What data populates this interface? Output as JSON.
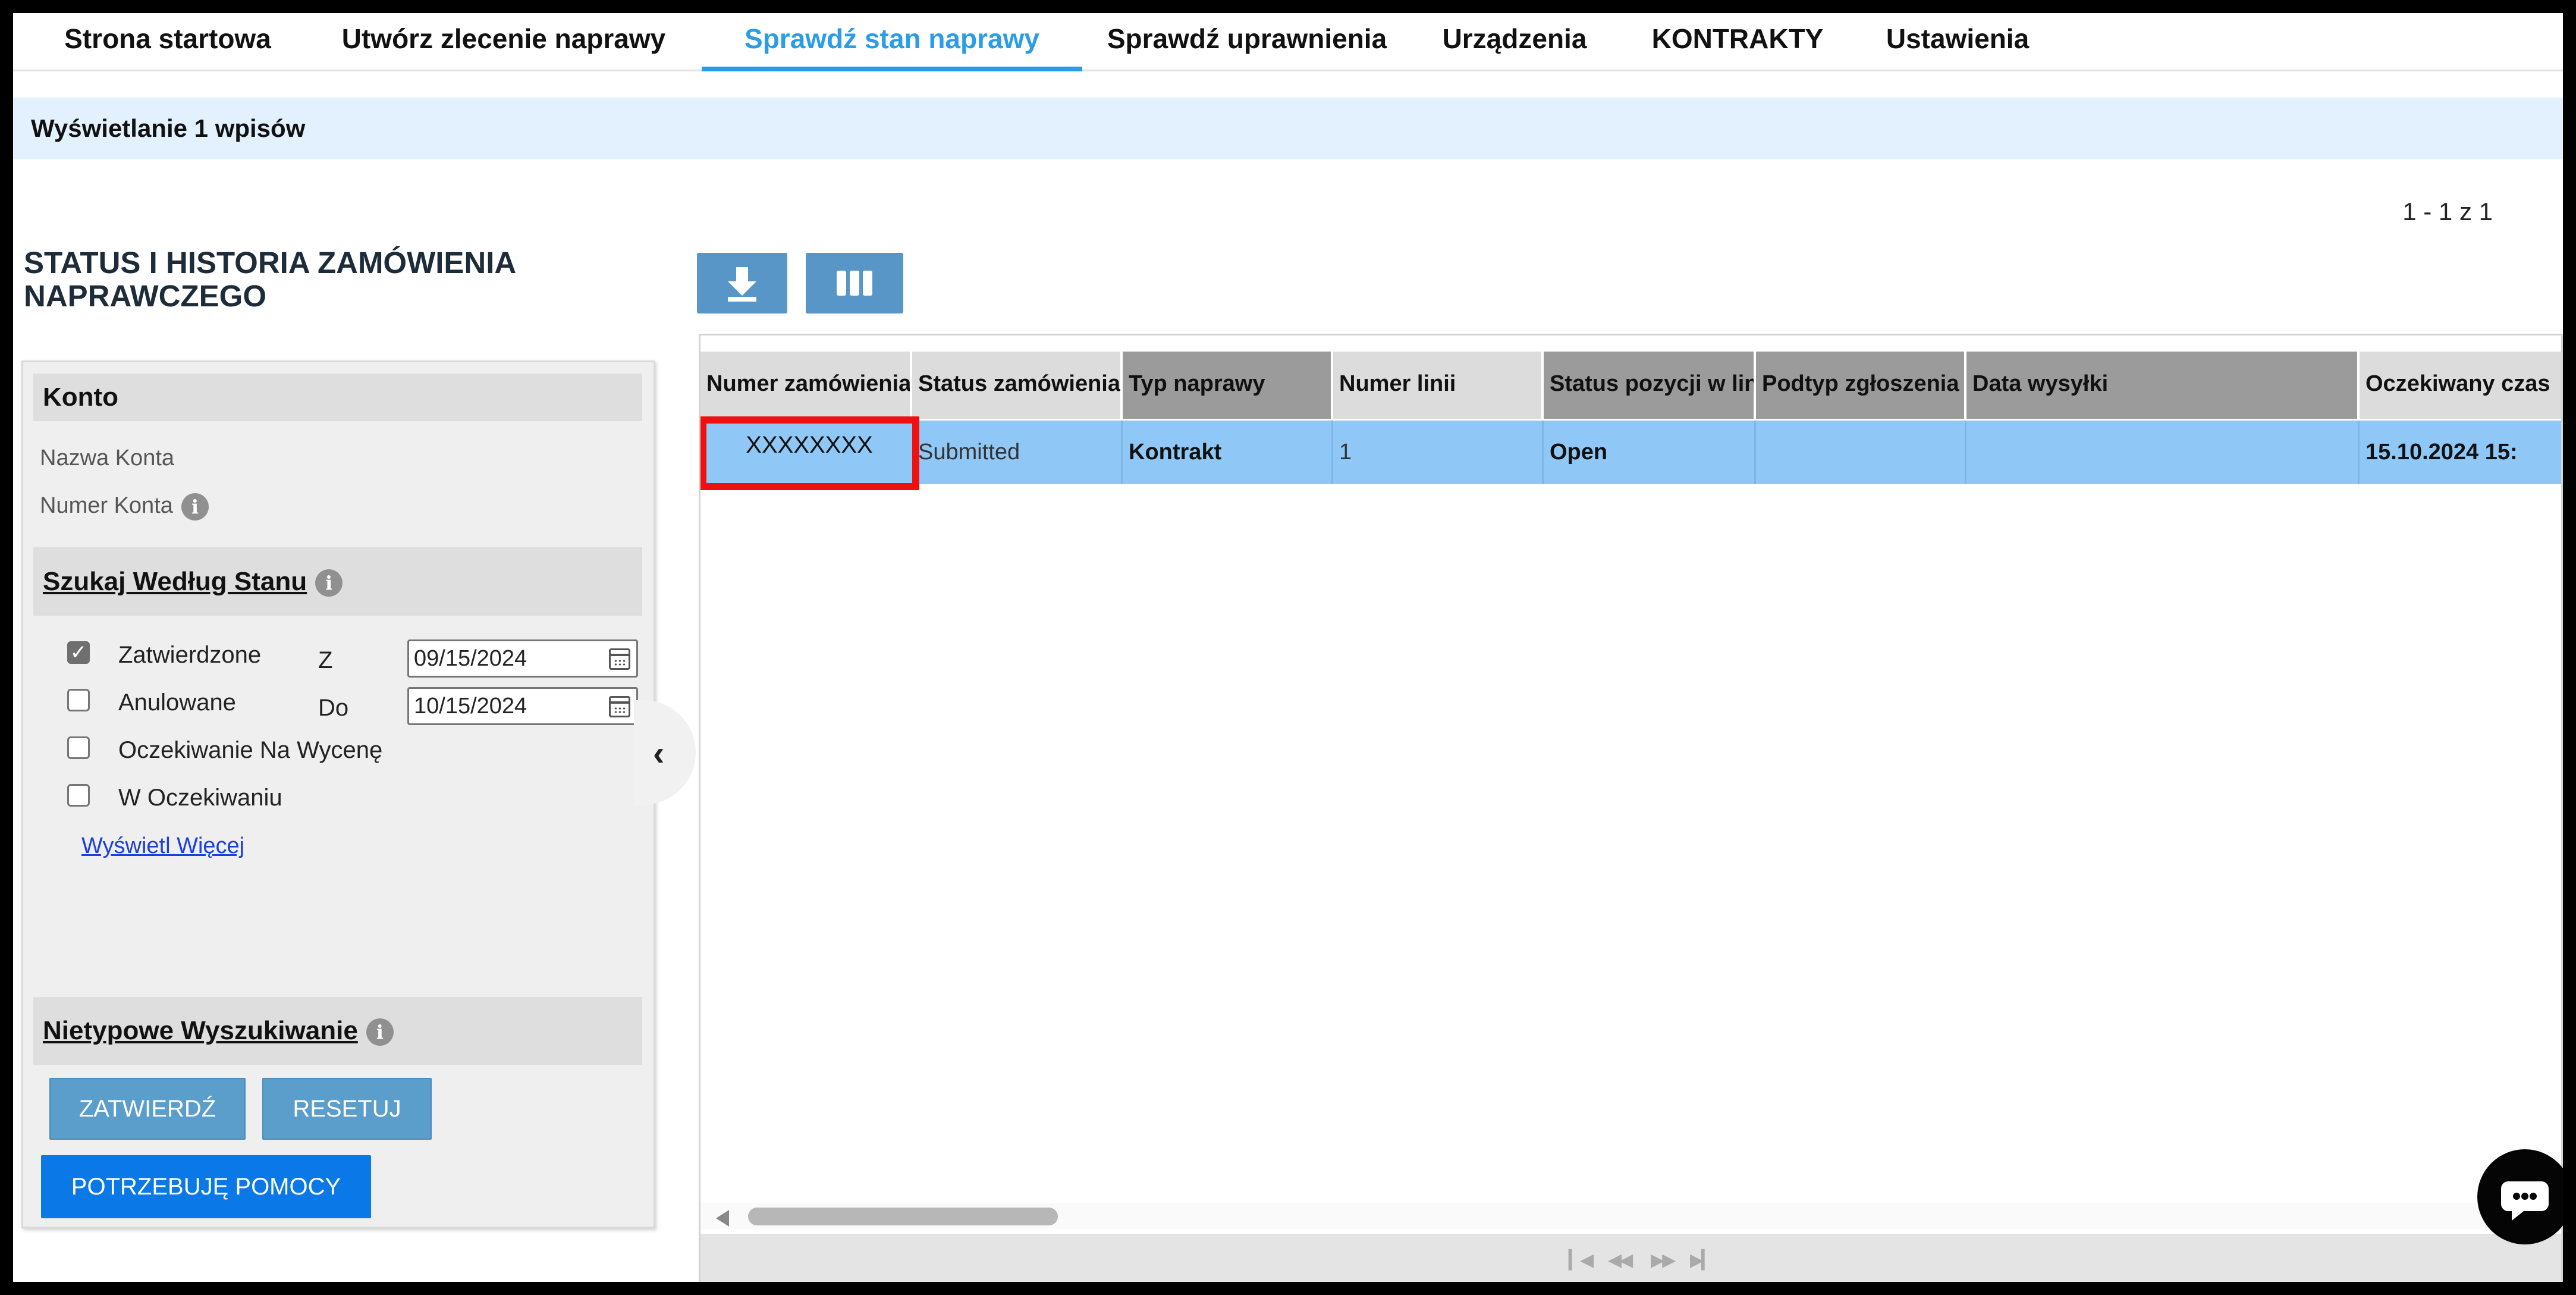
{
  "nav": {
    "tabs": [
      {
        "label": "Strona startowa",
        "active": false
      },
      {
        "label": "Utwórz zlecenie naprawy",
        "active": false
      },
      {
        "label": "Sprawdź stan naprawy",
        "active": true
      },
      {
        "label": "Sprawdź uprawnienia",
        "active": false
      },
      {
        "label": "Urządzenia",
        "active": false
      },
      {
        "label": "KONTRAKTY",
        "active": false
      },
      {
        "label": "Ustawienia",
        "active": false
      }
    ]
  },
  "info_bar": "Wyświetlanie 1 wpisów",
  "pagination_text": "1 - 1 z 1",
  "page_title": "STATUS I HISTORIA ZAMÓWIENIA NAPRAWCZEGO",
  "filters": {
    "account_heading": "Konto",
    "account_name_label": "Nazwa Konta",
    "account_number_label": "Numer Konta",
    "status_heading": "Szukaj Według Stanu",
    "statuses": [
      {
        "label": "Zatwierdzone",
        "checked": true
      },
      {
        "label": "Anulowane",
        "checked": false
      },
      {
        "label": "Oczekiwanie Na Wycenę",
        "checked": false
      },
      {
        "label": "W Oczekiwaniu",
        "checked": false
      }
    ],
    "date_from_label": "Z",
    "date_from": "09/15/2024",
    "date_to_label": "Do",
    "date_to": "10/15/2024",
    "show_more": "Wyświetl Więcej",
    "custom_search_heading": "Nietypowe Wyszukiwanie",
    "submit_label": "ZATWIERDŹ",
    "reset_label": "RESETUJ",
    "help_label": "POTRZEBUJĘ POMOCY"
  },
  "toolbar": {
    "download_icon": "download-icon",
    "columns_icon": "columns-icon"
  },
  "grid": {
    "columns": [
      "Numer zamówienia",
      "Status zamówienia",
      "Typ naprawy",
      "Numer linii",
      "Status pozycji w lin",
      "Podtyp zgłoszenia p",
      "Data wysyłki",
      "Oczekiwany czas"
    ],
    "rows": [
      {
        "order_number": "XXXXXXXX",
        "order_status": "Submitted",
        "repair_type": "Kontrakt",
        "line_number": "1",
        "line_status": "Open",
        "request_subtype": "",
        "ship_date": "",
        "expected_time": "15.10.2024 15:"
      }
    ]
  },
  "colors": {
    "accent": "#2a9de6",
    "info_bar_bg": "#e2f1fd",
    "selected_row": "#8fc8f6",
    "highlight_border": "#f01010",
    "primary_button": "#0a78e6",
    "secondary_button": "#5b9dcb"
  }
}
